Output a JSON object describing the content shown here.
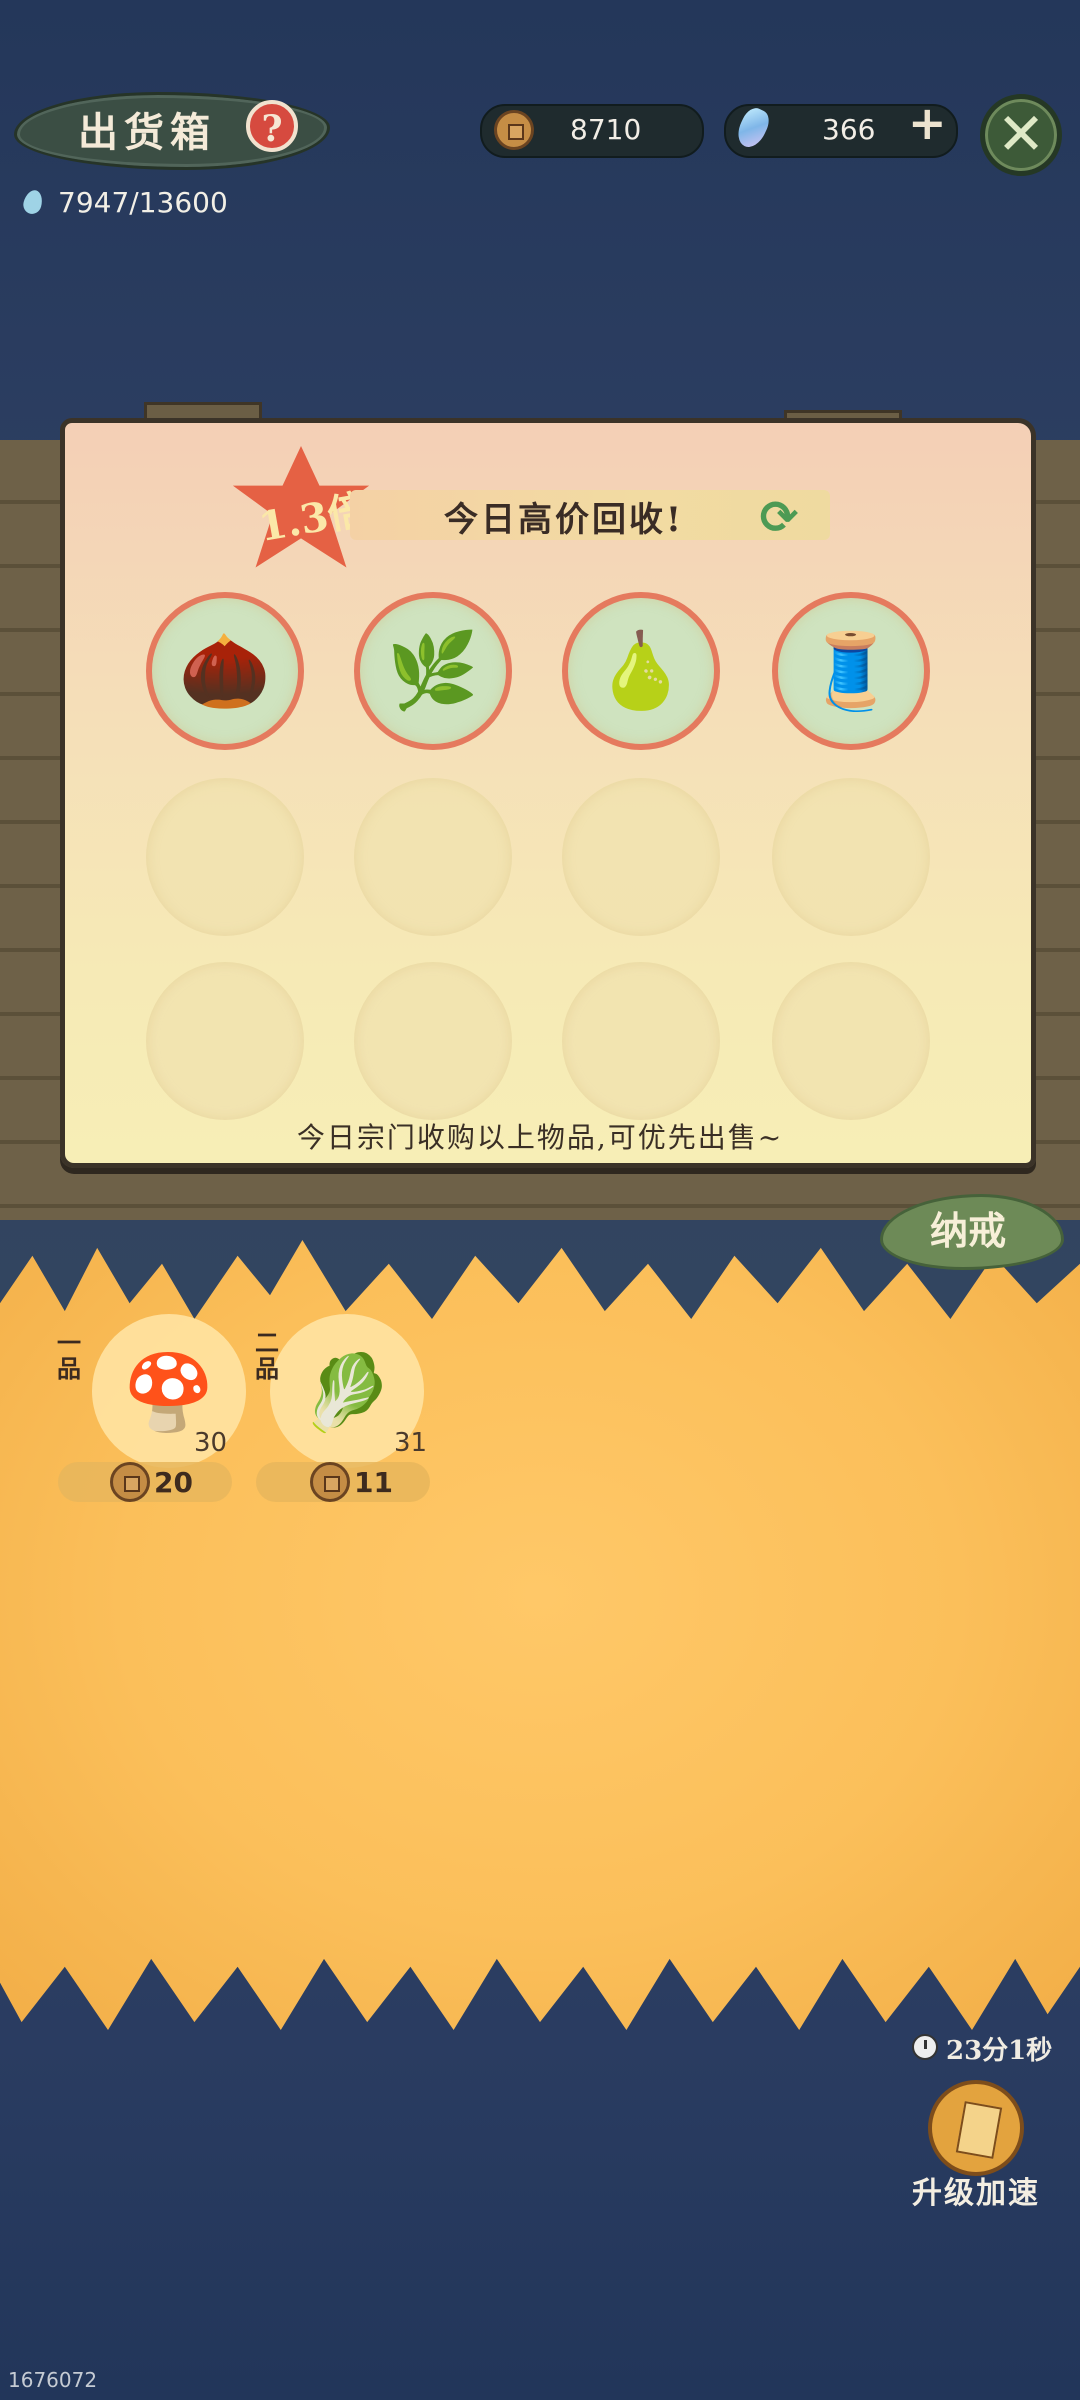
{
  "header": {
    "title": "出货箱",
    "help_icon": "question-mark-icon",
    "coins": "8710",
    "gems": "366",
    "energy": "7947/13600"
  },
  "board": {
    "multiplier": "1.3倍",
    "banner": "今日高价回收!",
    "note": "今日宗门收购以上物品,可优先出售~",
    "slots": [
      {
        "icon": "seeds-icon",
        "glyph": "🌰"
      },
      {
        "icon": "herb-icon",
        "glyph": "🌿"
      },
      {
        "icon": "pear-icon",
        "glyph": "🍐"
      },
      {
        "icon": "thread-spool-icon",
        "glyph": "🧵"
      },
      {},
      {},
      {},
      {},
      {},
      {},
      {},
      {}
    ]
  },
  "ring_tab": "纳戒",
  "inventory": [
    {
      "grade": "一品",
      "icon": "mushroom-icon",
      "glyph": "🍄",
      "qty": "30",
      "price": "20"
    },
    {
      "grade": "二品",
      "icon": "radish-icon",
      "glyph": "🥬",
      "qty": "31",
      "price": "11"
    }
  ],
  "speedup": {
    "timer": "23分1秒",
    "label": "升级加速"
  },
  "uid": "1676072",
  "colors": {
    "accent_red": "#e56144",
    "board_border": "#3b3328",
    "straw": "#fbbf5a"
  }
}
